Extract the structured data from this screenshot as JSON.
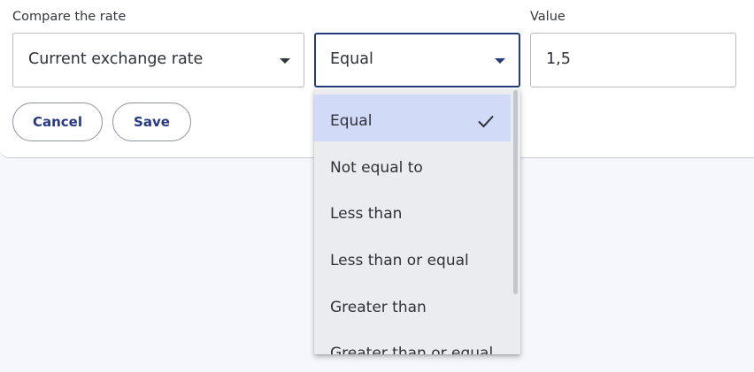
{
  "form": {
    "compare_label": "Compare the rate",
    "value_label": "Value",
    "compare_select": {
      "value": "Current exchange rate"
    },
    "operator_select": {
      "value": "Equal"
    },
    "value_input": {
      "value": "1,5"
    }
  },
  "buttons": {
    "cancel_label": "Cancel",
    "save_label": "Save"
  },
  "dropdown": {
    "options": [
      {
        "label": "Equal",
        "selected": true
      },
      {
        "label": "Not equal to",
        "selected": false
      },
      {
        "label": "Less than",
        "selected": false
      },
      {
        "label": "Less than or equal",
        "selected": false
      },
      {
        "label": "Greater than",
        "selected": false
      },
      {
        "label": "Greater than or equal",
        "selected": false
      }
    ]
  },
  "icons": {
    "caret": "caret-down-icon",
    "check": "check-icon"
  },
  "colors": {
    "accent": "#273a80",
    "selected_option": "#d1dbf8",
    "dropdown_bg": "#ebecf0",
    "page_bg": "#f5f7fc"
  }
}
